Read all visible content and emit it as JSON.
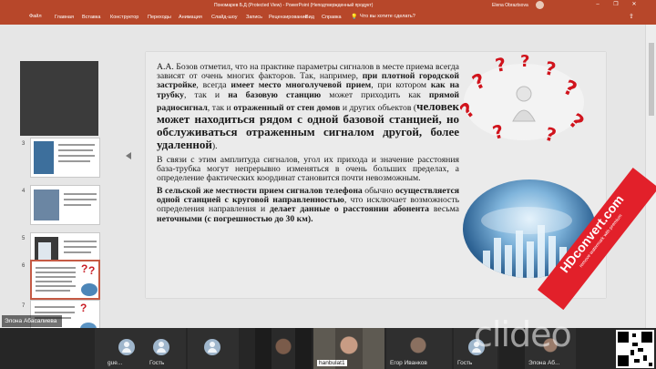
{
  "window": {
    "title": "Пономарев Б.Д (Protected View) - PowerPoint (Неподтвержденный продукт)",
    "user": "Elena Obraztsova"
  },
  "ribbon": {
    "tabs": [
      "Файл",
      "Главная",
      "Вставка",
      "Конструктор",
      "Переходы",
      "Анимация",
      "Слайд-шоу",
      "Запись",
      "Рецензирование",
      "Вид",
      "Справка"
    ],
    "tell_me": "Что вы хотите сделать?"
  },
  "thumbnails": [
    {
      "num": "3"
    },
    {
      "num": "4"
    },
    {
      "num": "5"
    },
    {
      "num": "6"
    },
    {
      "num": "7"
    }
  ],
  "slide": {
    "p1": [
      {
        "t": "А.А. Бозов отметил, что на практике параметры сигналов в месте приема всегда зависят от очень многих факторов. Так, например, ",
        "s": ""
      },
      {
        "t": "при плотной городской застройке",
        "s": "b"
      },
      {
        "t": ", всегда ",
        "s": ""
      },
      {
        "t": "имеет место многолучевой прием",
        "s": "b"
      },
      {
        "t": ", при котором ",
        "s": ""
      },
      {
        "t": "как на трубку",
        "s": "b"
      },
      {
        "t": ", так и ",
        "s": ""
      },
      {
        "t": "на базовую станцию",
        "s": "b"
      },
      {
        "t": " может приходить как ",
        "s": ""
      },
      {
        "t": "прямой радиосигнал",
        "s": "b"
      },
      {
        "t": ", так и ",
        "s": ""
      },
      {
        "t": "отраженный от стен домов",
        "s": "b"
      },
      {
        "t": " и других объектов (",
        "s": ""
      },
      {
        "t": "человек может находиться рядом с одной базовой станцией, но обслуживаться отраженным сигналом другой, более удаленной",
        "s": "big"
      },
      {
        "t": ").",
        "s": ""
      }
    ],
    "p2": "В связи с этим амплитуда сигналов, угол их прихода и значение расстояния база-трубка могут непрерывно изменяться в очень больших пределах, а определение фактических координат становится почти невозможным.",
    "p3": [
      {
        "t": "В сельской же местности прием сигналов телефона",
        "s": "b"
      },
      {
        "t": " обычно ",
        "s": ""
      },
      {
        "t": "осуществляется одной станцией с круговой направленностью",
        "s": "b"
      },
      {
        "t": ", что исключает возможность определения направления и ",
        "s": ""
      },
      {
        "t": "делает данные о расстоянии абонента",
        "s": "b"
      },
      {
        "t": " весьма ",
        "s": ""
      },
      {
        "t": "неточными (с погрешностью до 30 км).",
        "s": "b"
      }
    ]
  },
  "active_speaker": "Элона Абасалиева",
  "participants": [
    {
      "name": "gue..."
    },
    {
      "name": "Гость"
    },
    {
      "name": ""
    },
    {
      "name": ""
    },
    {
      "name": "hanbulat1"
    },
    {
      "name": "Егор Иванков"
    },
    {
      "name": "Гость"
    },
    {
      "name": ""
    },
    {
      "name": "Элона Аб..."
    }
  ],
  "watermark": {
    "clideo": "clideo",
    "hd_main": "HDconvert.com",
    "hd_sub": "remove watermark with premium"
  },
  "colors": {
    "ppt_accent": "#b7472a",
    "hd_red": "#e2202a"
  },
  "icons": [
    "minimize-icon",
    "restore-icon",
    "close-icon",
    "lightbulb-icon",
    "share-icon",
    "user-avatar-icon",
    "question-marks-image",
    "world-business-image"
  ]
}
